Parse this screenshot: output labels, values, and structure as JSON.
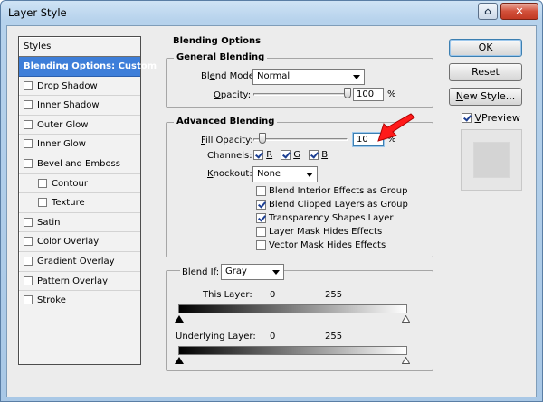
{
  "window": {
    "title": "Layer Style",
    "help_glyph": "⌂",
    "close_glyph": "✕"
  },
  "styles_panel": {
    "header": "Styles",
    "items": [
      {
        "label": "Blending Options: Custom",
        "selected": true
      },
      {
        "label": "Drop Shadow"
      },
      {
        "label": "Inner Shadow"
      },
      {
        "label": "Outer Glow"
      },
      {
        "label": "Inner Glow"
      },
      {
        "label": "Bevel and Emboss"
      },
      {
        "label": "Contour",
        "sub": true
      },
      {
        "label": "Texture",
        "sub": true
      },
      {
        "label": "Satin"
      },
      {
        "label": "Color Overlay"
      },
      {
        "label": "Gradient Overlay"
      },
      {
        "label": "Pattern Overlay"
      },
      {
        "label": "Stroke"
      }
    ]
  },
  "buttons": {
    "ok": "OK",
    "reset": "Reset",
    "new_style": "New Style...",
    "preview": "Preview",
    "preview_checked": true
  },
  "blending_options": {
    "title": "Blending Options",
    "general": {
      "title": "General Blending",
      "blend_mode_label": "Blend Mode:",
      "blend_mode_value": "Normal",
      "opacity_label": "Opacity:",
      "opacity_value": "100",
      "opacity_unit": "%",
      "opacity_fraction": 1.0
    },
    "advanced": {
      "title": "Advanced Blending",
      "fill_opacity_label": "Fill Opacity:",
      "fill_opacity_value": "10",
      "fill_opacity_unit": "%",
      "fill_opacity_fraction": 0.1,
      "channels_label": "Channels:",
      "channels": [
        "R",
        "G",
        "B"
      ],
      "knockout_label": "Knockout:",
      "knockout_value": "None",
      "options": [
        {
          "label": "Blend Interior Effects as Group",
          "checked": false
        },
        {
          "label": "Blend Clipped Layers as Group",
          "checked": true
        },
        {
          "label": "Transparency Shapes Layer",
          "checked": true
        },
        {
          "label": "Layer Mask Hides Effects",
          "checked": false
        },
        {
          "label": "Vector Mask Hides Effects",
          "checked": false
        }
      ]
    },
    "blend_if": {
      "label": "Blend If:",
      "value": "Gray",
      "this_layer_label": "This Layer:",
      "this_layer_min": "0",
      "this_layer_max": "255",
      "underlying_label": "Underlying Layer:",
      "underlying_min": "0",
      "underlying_max": "255"
    }
  },
  "colors": {
    "selection": "#3d7ed9",
    "annotation_arrow": "#ff1a1a",
    "window_frame": "#a9c8e6"
  }
}
